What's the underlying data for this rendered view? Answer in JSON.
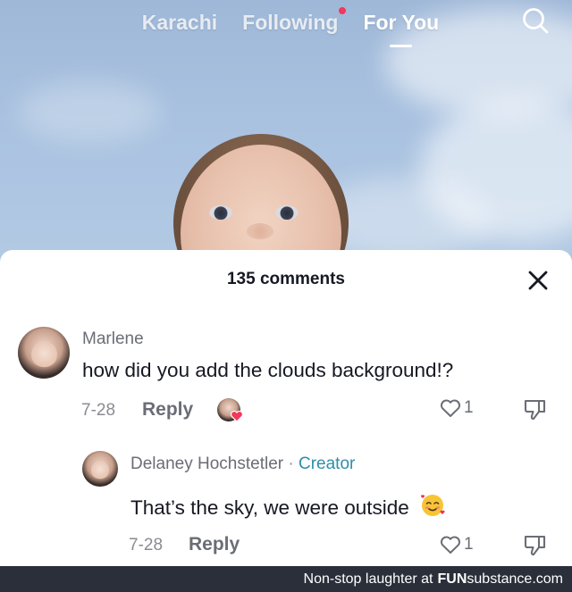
{
  "topnav": {
    "tabs": [
      {
        "label": "Karachi",
        "active": false
      },
      {
        "label": "Following",
        "active": false,
        "live_dot": true
      },
      {
        "label": "For You",
        "active": true
      }
    ],
    "search_icon": "search-icon"
  },
  "panel": {
    "comment_count": "135 comments",
    "close_icon": "close-icon"
  },
  "comments": [
    {
      "username": "Marlene",
      "text": "how did you add the clouds background!?",
      "date": "7-28",
      "reply_label": "Reply",
      "liked_by_creator": true,
      "likes": "1"
    },
    {
      "username": "Delaney Hochstetler",
      "separator": "·",
      "badge": "Creator",
      "text": "That’s the sky, we were outside",
      "emoji": "smiling-face-with-hearts",
      "date": "7-28",
      "reply_label": "Reply",
      "likes": "1"
    }
  ],
  "footer": {
    "caption": "Non-stop laughter at",
    "brand_bold": "FUN",
    "brand_rest": "substance.com"
  },
  "colors": {
    "sky": "#a9c2e0",
    "text_primary": "#161823",
    "text_secondary": "#6b6d76",
    "creator": "#2f8ea7",
    "live_dot": "#f3385a",
    "footer_bg": "#2b2f3a"
  }
}
